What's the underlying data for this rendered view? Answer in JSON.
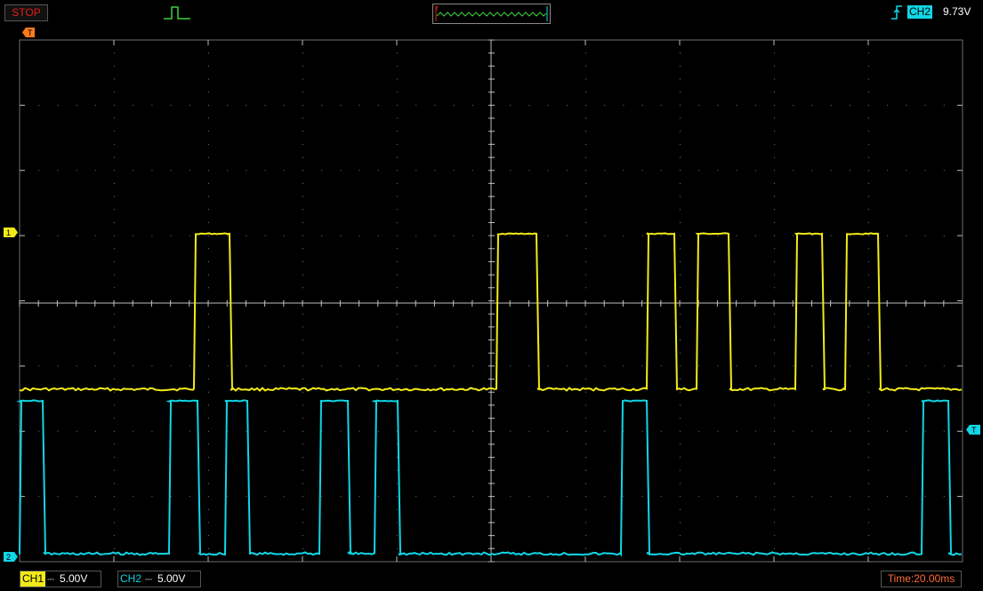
{
  "status": {
    "run_state": "STOP"
  },
  "trigger": {
    "source": "CH2",
    "level": "9.73V",
    "marker": "T"
  },
  "channels": {
    "ch1": {
      "label": "CH1",
      "coupling": "DC",
      "scale": "5.00V",
      "marker": "1",
      "color": "#f2ea18"
    },
    "ch2": {
      "label": "CH2",
      "coupling": "DC",
      "scale": "5.00V",
      "marker": "2",
      "color": "#10d6e6"
    }
  },
  "timebase": {
    "label": "Time:20.00ms"
  },
  "colors": {
    "background": "#000000",
    "grid": "#6e6e6e",
    "stop": "#e0201a",
    "time": "#ff6a3a"
  },
  "icons": {
    "pulse": "pulse-icon",
    "trigger_edge": "rising-edge-icon",
    "memory_preview": "waveform-preview-icon"
  }
}
